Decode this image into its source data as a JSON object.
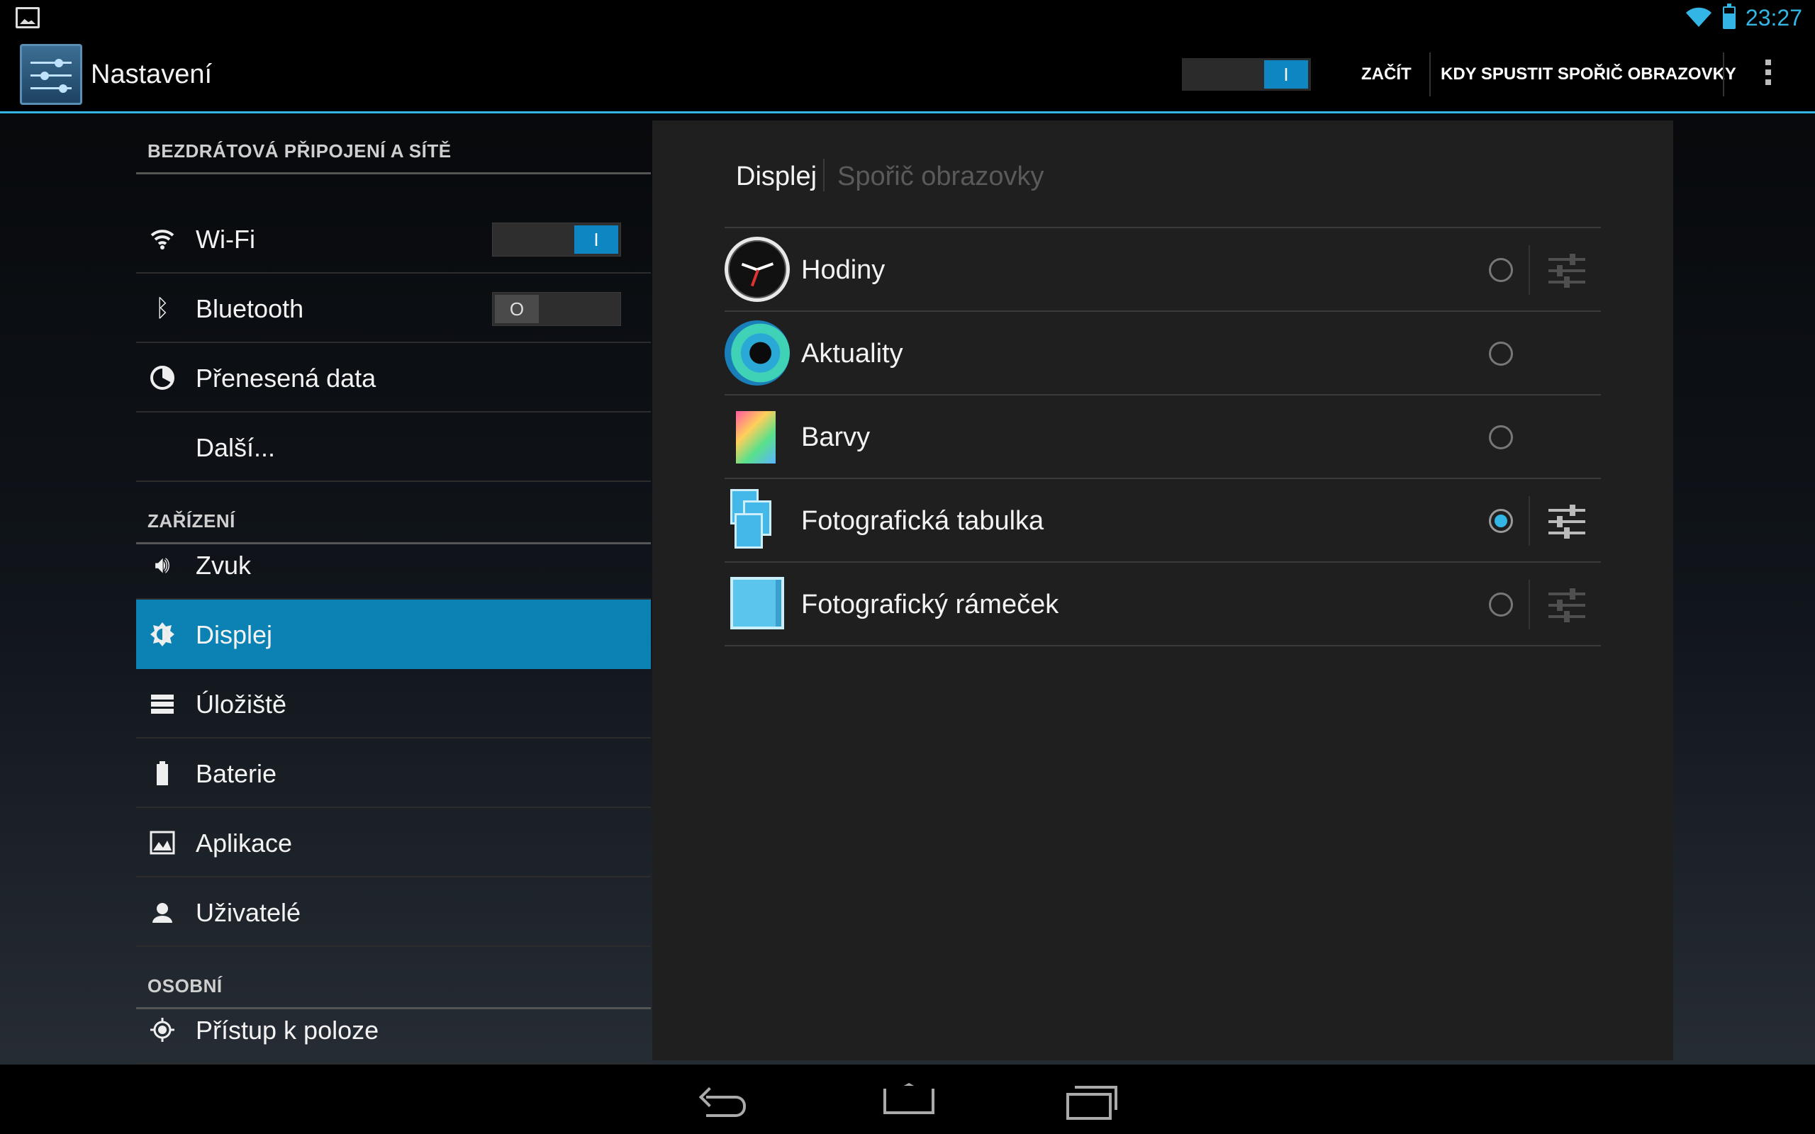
{
  "status_bar": {
    "time": "23:27",
    "icons": [
      "gallery-notification-icon",
      "wifi-icon",
      "battery-icon"
    ]
  },
  "action_bar": {
    "title": "Nastavení",
    "master_switch": {
      "state": "on",
      "label": "I"
    },
    "start_button": "ZAČÍT",
    "when_button": "KDY SPUSTIT SPOŘIČ OBRAZOVKY",
    "overflow": "overflow-menu-icon"
  },
  "sidebar": {
    "sections": [
      {
        "header": "BEZDRÁTOVÁ PŘIPOJENÍ A SÍTĚ"
      },
      {
        "header": "ZAŘÍZENÍ"
      },
      {
        "header": "OSOBNÍ"
      }
    ],
    "items": [
      {
        "label": "Wi-Fi",
        "icon": "wifi-icon",
        "switch": "I",
        "switch_state": "on"
      },
      {
        "label": "Bluetooth",
        "icon": "bluetooth-icon",
        "switch": "O",
        "switch_state": "off"
      },
      {
        "label": "Přenesená data",
        "icon": "data-usage-icon"
      },
      {
        "label": "Další..."
      },
      {
        "label": "Zvuk",
        "icon": "speaker-icon"
      },
      {
        "label": "Displej",
        "icon": "brightness-icon",
        "selected": true
      },
      {
        "label": "Úložiště",
        "icon": "storage-icon"
      },
      {
        "label": "Baterie",
        "icon": "battery-icon"
      },
      {
        "label": "Aplikace",
        "icon": "apps-icon"
      },
      {
        "label": "Uživatelé",
        "icon": "user-icon"
      },
      {
        "label": "Přístup k poloze",
        "icon": "location-icon"
      }
    ]
  },
  "main": {
    "breadcrumb": {
      "parent": "Displej",
      "current": "Spořič obrazovky"
    },
    "screensavers": [
      {
        "label": "Hodiny",
        "icon": "clock-icon",
        "selected": false,
        "has_settings": true,
        "settings_enabled": false
      },
      {
        "label": "Aktuality",
        "icon": "currents-icon",
        "selected": false,
        "has_settings": false
      },
      {
        "label": "Barvy",
        "icon": "colors-icon",
        "selected": false,
        "has_settings": false
      },
      {
        "label": "Fotografická tabulka",
        "icon": "photo-table-icon",
        "selected": true,
        "has_settings": true,
        "settings_enabled": true
      },
      {
        "label": "Fotografický rámeček",
        "icon": "photo-frame-icon",
        "selected": false,
        "has_settings": true,
        "settings_enabled": false
      }
    ]
  },
  "nav_bar": [
    "back-icon",
    "home-icon",
    "recent-apps-icon"
  ],
  "colors": {
    "accent": "#33b5e5",
    "selected_bg": "#0c81b3"
  }
}
